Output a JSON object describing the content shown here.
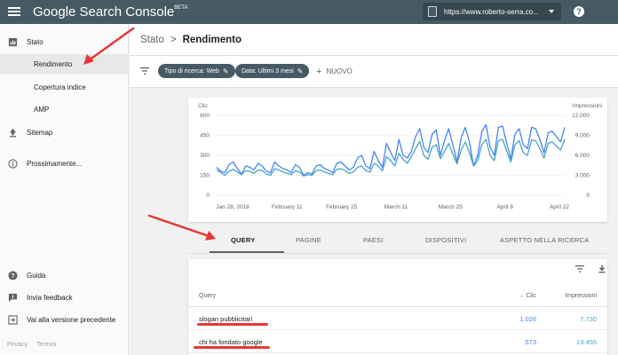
{
  "app": {
    "title": "Google Search Console",
    "badge": "BETA",
    "property_url": "https://www.roberto-serra.co...",
    "help_glyph": "?"
  },
  "sidebar": {
    "items": [
      {
        "label": "Stato",
        "icon": "bar-chart-icon"
      },
      {
        "label": "Rendimento",
        "icon": ""
      },
      {
        "label": "Copertura indice",
        "icon": ""
      },
      {
        "label": "AMP",
        "icon": ""
      },
      {
        "label": "Sitemap",
        "icon": "upload-icon"
      },
      {
        "label": "Prossimamente...",
        "icon": "info-icon"
      },
      {
        "label": "Guida",
        "icon": "help-icon"
      },
      {
        "label": "Invia feedback",
        "icon": "feedback-icon"
      },
      {
        "label": "Vai alla versione precedente",
        "icon": "exit-icon"
      }
    ],
    "footer": {
      "privacy": "Privacy",
      "terms": "Termini"
    }
  },
  "header": {
    "breadcrumb_parent": "Stato",
    "separator": ">",
    "breadcrumb_current": "Rendimento"
  },
  "filters": {
    "chips": [
      "Tipo di ricerca: Web",
      "Data: Ultimi 3 mesi"
    ],
    "new_label": "NUOVO"
  },
  "chart_data": {
    "type": "line",
    "left_axis_label": "Clic",
    "right_axis_label": "Impressioni",
    "left_ticks": [
      "600",
      "450",
      "300",
      "150",
      "0"
    ],
    "right_ticks": [
      "12.000",
      "9.000",
      "6.000",
      "3.000",
      "0"
    ],
    "x_ticks": [
      "Jan 28, 2018",
      "February 11",
      "February 25",
      "March 11",
      "March 25",
      "April 8",
      "April 22"
    ],
    "ylim_left": [
      0,
      600
    ],
    "ylim_right": [
      0,
      12000
    ],
    "series": [
      {
        "name": "Clic",
        "color": "#4285f4",
        "values": [
          210,
          180,
          170,
          230,
          250,
          200,
          160,
          220,
          210,
          190,
          240,
          220,
          180,
          170,
          250,
          220,
          200,
          190,
          170,
          230,
          210,
          150,
          170,
          160,
          220,
          230,
          200,
          190,
          170,
          240,
          250,
          220,
          190,
          210,
          280,
          300,
          220,
          200,
          330,
          260,
          210,
          390,
          320,
          260,
          420,
          300,
          280,
          330,
          440,
          500,
          360,
          320,
          460,
          490,
          300,
          410,
          500,
          380,
          250,
          430,
          510,
          400,
          220,
          300,
          480,
          530,
          360,
          300,
          510,
          520,
          390,
          270,
          460,
          500,
          380,
          350,
          510,
          500,
          420,
          320,
          470,
          480,
          440,
          400,
          510
        ]
      },
      {
        "name": "Impressioni",
        "color": "#4aa3c4",
        "values": [
          3800,
          3400,
          3000,
          3600,
          3900,
          3500,
          3100,
          3700,
          3600,
          3300,
          3800,
          3700,
          3200,
          3000,
          4000,
          3800,
          3500,
          3300,
          3100,
          3700,
          3500,
          2900,
          3100,
          3000,
          3700,
          3800,
          3500,
          3300,
          3100,
          3900,
          4000,
          3700,
          3300,
          3500,
          4200,
          4400,
          3700,
          3500,
          4800,
          4400,
          3700,
          5800,
          5200,
          4400,
          6300,
          5400,
          4800,
          5800,
          7000,
          8100,
          6000,
          5400,
          7200,
          7600,
          5500,
          6600,
          7800,
          6200,
          4700,
          6800,
          8000,
          6400,
          4400,
          5200,
          7600,
          8400,
          6000,
          5200,
          8200,
          8400,
          6600,
          5000,
          7600,
          8200,
          6400,
          6000,
          8300,
          8200,
          7000,
          5600,
          7800,
          8000,
          7400,
          6800,
          8400
        ]
      }
    ]
  },
  "tabs": [
    "QUERY",
    "PAGINE",
    "PAESI",
    "DISPOSITIVI",
    "ASPETTO NELLA RICERCA"
  ],
  "table": {
    "columns": {
      "query": "Query",
      "clicks": "Clic",
      "impressions": "Impressioni"
    },
    "rows": [
      {
        "query": "slogan pubblicitari",
        "clicks": "1.026",
        "impressions": "7.730"
      },
      {
        "query": "chi ha fondato google",
        "clicks": "573",
        "impressions": "13.455"
      }
    ]
  },
  "colors": {
    "appbar": "#455a64",
    "clicks": "#4285f4",
    "impressions": "#4aa3c4",
    "annotation": "#e53935"
  }
}
